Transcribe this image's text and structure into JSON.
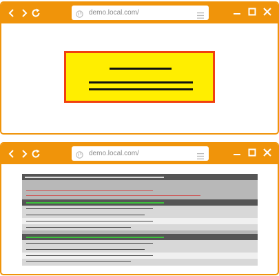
{
  "windows": [
    {
      "id": "top",
      "url": "demo.local.com/",
      "content": "yellow-dialog"
    },
    {
      "id": "bottom",
      "url": "demo.local.com/",
      "content": "grey-table"
    }
  ],
  "colors": {
    "frame": "#f0940a",
    "dialog_fill": "#ffee00",
    "dialog_border": "#f04010",
    "table_dark": "#555555",
    "table_mid": "#b8b8b8",
    "table_light": "#d8d8d8",
    "table_pale": "#f0f0f0",
    "accent_green": "#3cc23c",
    "accent_red": "#d05050"
  },
  "icons": [
    "back-icon",
    "forward-icon",
    "reload-icon",
    "globe-icon",
    "menu-icon",
    "minimize-icon",
    "maximize-icon",
    "close-icon"
  ]
}
